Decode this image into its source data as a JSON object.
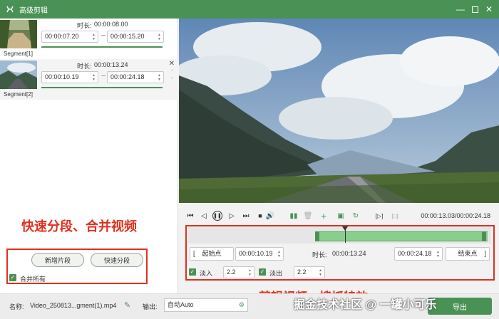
{
  "window": {
    "title": "高级剪辑",
    "accent_color": "#4a9155",
    "annotation_color": "#e0301e"
  },
  "segments": [
    {
      "name": "Segment[1]",
      "duration_label": "时长:",
      "duration": "00:00:08.00",
      "start": "00:00:07.20",
      "end": "00:00:15.20"
    },
    {
      "name": "Segment[2]",
      "duration_label": "时长:",
      "duration": "00:00:13.24",
      "start": "00:00:10.19",
      "end": "00:00:24.18"
    }
  ],
  "left_actions": {
    "annotation": "快速分段、合并视频",
    "add_segment": "新增片段",
    "quick_split": "快速分段",
    "merge_all": "合并所有"
  },
  "player": {
    "time_readout": "00:00:13.03/00:00:24.18",
    "icons": [
      "skip-start-icon",
      "prev-frame-icon",
      "pause-icon",
      "next-frame-icon",
      "skip-end-icon",
      "volume-icon",
      "split-icon",
      "delete-icon",
      "add-icon",
      "copy-icon",
      "reset-icon",
      "mark-in-out-icon",
      "fit-icon"
    ]
  },
  "trim": {
    "start_btn": "起始点",
    "start_time": "00:00:10.19",
    "duration_label": "时长:",
    "duration": "00:00:13.24",
    "end_time": "00:00:24.18",
    "end_btn": "结束点",
    "fade_in_label": "淡入",
    "fade_in": "2.2",
    "fade_out_label": "淡出",
    "fade_out": "2.2",
    "annotation": "剪辑视频、搜抓特效"
  },
  "bottom": {
    "name_label": "名称:",
    "name_value": "Video_250813...gment(1).mp4",
    "output_label": "输出:",
    "output_value": "自动Auto",
    "export_label": "导出"
  },
  "watermark": "掘金技术社区 @ 一罐小可乐"
}
